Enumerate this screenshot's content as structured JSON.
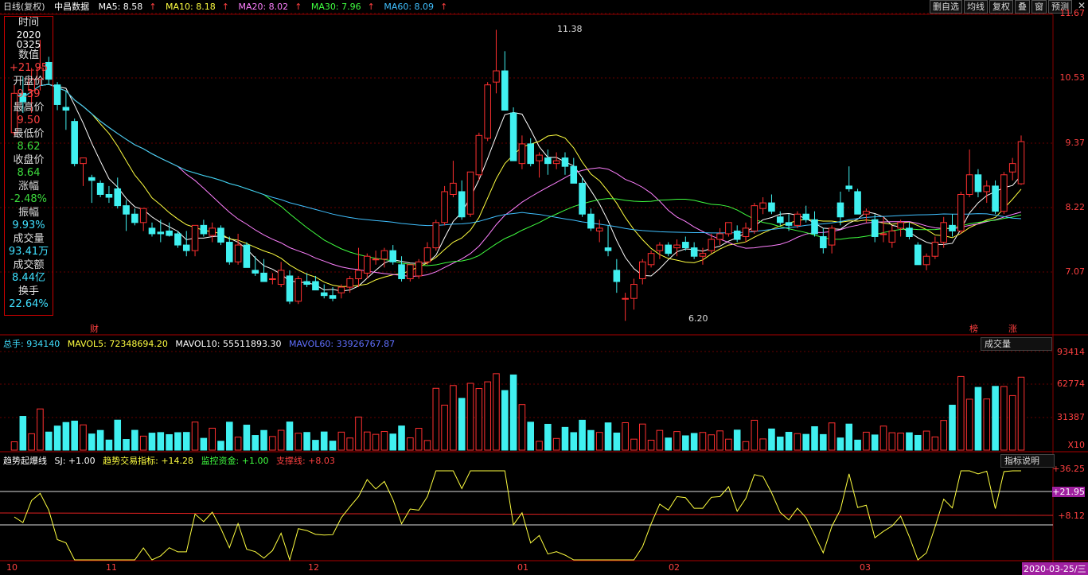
{
  "header": {
    "period": "日线(复权)",
    "name": "中昌数据",
    "ma": [
      {
        "label": "MA5: 8.58",
        "color": "#ffffff"
      },
      {
        "label": "MA10: 8.18",
        "color": "#ffff40"
      },
      {
        "label": "MA20: 8.02",
        "color": "#ff80ff"
      },
      {
        "label": "MA30: 7.96",
        "color": "#40ff40"
      },
      {
        "label": "MA60: 8.09",
        "color": "#40c0ff"
      }
    ],
    "buttons": [
      "删自选",
      "均线",
      "复权",
      "叠",
      "窗",
      "预测"
    ],
    "close": "✕"
  },
  "info": {
    "rows": [
      {
        "k": "时间",
        "v": "2020",
        "v2": "0325",
        "c": "white"
      },
      {
        "k": "数值",
        "v": "+21.95",
        "c": "red"
      },
      {
        "k": "开盘价",
        "v": "9.39",
        "c": "red"
      },
      {
        "k": "最高价",
        "v": "9.50",
        "c": "red"
      },
      {
        "k": "最低价",
        "v": "8.62",
        "c": "green"
      },
      {
        "k": "收盘价",
        "v": "8.64",
        "c": "green"
      },
      {
        "k": "涨幅",
        "v": "-2.48%",
        "c": "green"
      },
      {
        "k": "振幅",
        "v": "9.93%",
        "c": "cyan"
      },
      {
        "k": "成交量",
        "v": "93.41万",
        "c": "cyan"
      },
      {
        "k": "成交额",
        "v": "8.44亿",
        "c": "cyan"
      },
      {
        "k": "换手",
        "v": "22.64%",
        "c": "cyan"
      }
    ]
  },
  "price_axis": [
    "11.67",
    "10.53",
    "9.37",
    "8.22",
    "7.07"
  ],
  "annotations": {
    "high": "11.38",
    "low": "6.20",
    "cai": "财",
    "bang": "榜",
    "zhang": "涨"
  },
  "vol_bar": {
    "total": "总手: 934140",
    "mavol5": "MAVOL5: 72348694.20",
    "mavol10": "MAVOL10: 55511893.30",
    "mavol60": "MAVOL60: 33926767.87",
    "dropdown": "成交量"
  },
  "vol_axis": [
    "93414",
    "62774",
    "31387",
    "X10"
  ],
  "ind_bar": {
    "name": "趋势起爆线",
    "sj": "SJ: +1.00",
    "trade": "趋势交易指标: +14.28",
    "fund": "监控资金: +1.00",
    "support": "支撑线: +8.03",
    "button": "指标说明"
  },
  "ind_axis": [
    "+36.25",
    "+21.95",
    "+8.12"
  ],
  "x_labels": [
    "10",
    "11",
    "12",
    "01",
    "02",
    "03"
  ],
  "date_label": "2020-03-25/三",
  "chart_data": {
    "type": "candlestick",
    "ohlc": [
      [
        9.55,
        10.4,
        9.5,
        10.25
      ],
      [
        10.25,
        10.55,
        9.9,
        10.1
      ],
      [
        10.3,
        10.7,
        9.9,
        10.5
      ],
      [
        10.5,
        11.2,
        10.3,
        10.7
      ],
      [
        10.8,
        10.9,
        10.4,
        10.5
      ],
      [
        10.4,
        10.45,
        9.95,
        10.05
      ],
      [
        10.0,
        10.3,
        9.6,
        9.95
      ],
      [
        9.75,
        9.8,
        8.95,
        9.0
      ],
      [
        9.0,
        9.1,
        8.6,
        9.1
      ],
      [
        8.75,
        8.8,
        8.3,
        8.7
      ],
      [
        8.65,
        8.7,
        8.4,
        8.45
      ],
      [
        8.45,
        8.6,
        8.3,
        8.4
      ],
      [
        8.55,
        8.75,
        8.2,
        8.25
      ],
      [
        8.25,
        8.35,
        7.8,
        8.1
      ],
      [
        8.1,
        8.2,
        7.9,
        7.95
      ],
      [
        7.95,
        8.2,
        7.8,
        8.2
      ],
      [
        7.85,
        7.95,
        7.7,
        7.75
      ],
      [
        7.78,
        8.0,
        7.6,
        7.75
      ],
      [
        7.8,
        7.95,
        7.7,
        7.72
      ],
      [
        7.75,
        7.8,
        7.5,
        7.55
      ],
      [
        7.55,
        7.8,
        7.35,
        7.45
      ],
      [
        7.45,
        7.9,
        7.35,
        7.9
      ],
      [
        7.9,
        8.0,
        7.7,
        7.75
      ],
      [
        7.72,
        7.95,
        7.6,
        7.85
      ],
      [
        7.85,
        7.9,
        7.55,
        7.6
      ],
      [
        7.6,
        7.7,
        7.2,
        7.25
      ],
      [
        7.25,
        7.75,
        7.2,
        7.55
      ],
      [
        7.55,
        7.6,
        7.15,
        7.15
      ],
      [
        7.1,
        7.35,
        7.0,
        7.05
      ],
      [
        7.05,
        7.3,
        6.95,
        6.9
      ],
      [
        6.95,
        7.05,
        6.85,
        6.95
      ],
      [
        6.85,
        7.25,
        6.8,
        7.1
      ],
      [
        7.0,
        7.1,
        6.5,
        6.55
      ],
      [
        6.55,
        7.0,
        6.5,
        6.95
      ],
      [
        6.9,
        7.05,
        6.8,
        6.85
      ],
      [
        6.9,
        7.0,
        6.8,
        6.75
      ],
      [
        6.7,
        6.85,
        6.6,
        6.65
      ],
      [
        6.65,
        6.8,
        6.55,
        6.6
      ],
      [
        6.7,
        6.85,
        6.6,
        6.8
      ],
      [
        6.8,
        7.0,
        6.7,
        6.95
      ],
      [
        6.95,
        7.5,
        6.8,
        7.1
      ],
      [
        7.05,
        7.4,
        6.95,
        7.35
      ],
      [
        7.3,
        7.45,
        7.2,
        7.3
      ],
      [
        7.3,
        7.5,
        7.15,
        7.45
      ],
      [
        7.45,
        7.55,
        7.2,
        7.25
      ],
      [
        7.2,
        7.35,
        6.9,
        6.95
      ],
      [
        6.95,
        7.2,
        6.9,
        7.2
      ],
      [
        7.0,
        7.3,
        6.95,
        7.25
      ],
      [
        7.25,
        7.6,
        7.2,
        7.5
      ],
      [
        7.5,
        8.0,
        7.45,
        7.95
      ],
      [
        7.95,
        8.6,
        7.9,
        8.5
      ],
      [
        8.45,
        9.05,
        8.4,
        8.65
      ],
      [
        8.5,
        8.7,
        8.0,
        8.05
      ],
      [
        8.1,
        8.85,
        8.05,
        8.85
      ],
      [
        8.8,
        9.55,
        8.7,
        9.5
      ],
      [
        9.45,
        10.45,
        9.4,
        10.4
      ],
      [
        10.45,
        11.38,
        10.25,
        10.65
      ],
      [
        10.65,
        11.0,
        9.95,
        9.95
      ],
      [
        9.9,
        10.0,
        9.05,
        9.05
      ],
      [
        9.0,
        9.5,
        8.9,
        9.35
      ],
      [
        9.35,
        9.45,
        8.95,
        9.0
      ],
      [
        9.05,
        9.2,
        8.75,
        9.15
      ],
      [
        9.1,
        9.25,
        8.8,
        9.0
      ],
      [
        9.0,
        9.2,
        8.9,
        9.05
      ],
      [
        9.1,
        9.2,
        8.8,
        8.95
      ],
      [
        8.95,
        9.1,
        8.65,
        8.65
      ],
      [
        8.65,
        8.75,
        8.05,
        8.1
      ],
      [
        8.1,
        8.2,
        7.8,
        7.85
      ],
      [
        7.8,
        8.0,
        7.6,
        7.85
      ],
      [
        7.5,
        7.9,
        7.35,
        7.45
      ],
      [
        7.1,
        7.3,
        6.7,
        6.9
      ],
      [
        6.6,
        6.7,
        6.2,
        6.6
      ],
      [
        6.6,
        6.95,
        6.4,
        6.85
      ],
      [
        6.95,
        7.3,
        6.85,
        7.25
      ],
      [
        7.2,
        7.45,
        7.15,
        7.4
      ],
      [
        7.45,
        7.6,
        7.3,
        7.55
      ],
      [
        7.55,
        7.6,
        7.35,
        7.4
      ],
      [
        7.5,
        7.65,
        7.35,
        7.55
      ],
      [
        7.6,
        7.7,
        7.45,
        7.5
      ],
      [
        7.5,
        7.6,
        7.3,
        7.35
      ],
      [
        7.35,
        7.5,
        7.2,
        7.4
      ],
      [
        7.45,
        7.75,
        7.4,
        7.65
      ],
      [
        7.65,
        7.85,
        7.55,
        7.75
      ],
      [
        7.75,
        7.95,
        7.7,
        7.95
      ],
      [
        7.8,
        7.9,
        7.6,
        7.65
      ],
      [
        7.7,
        7.95,
        7.6,
        7.85
      ],
      [
        7.8,
        8.3,
        7.75,
        8.25
      ],
      [
        8.2,
        8.4,
        8.1,
        8.3
      ],
      [
        8.3,
        8.45,
        8.1,
        8.15
      ],
      [
        8.05,
        8.15,
        7.9,
        7.95
      ],
      [
        7.95,
        8.1,
        7.8,
        7.9
      ],
      [
        7.9,
        8.15,
        7.85,
        8.1
      ],
      [
        8.1,
        8.25,
        7.95,
        8.0
      ],
      [
        8.0,
        8.15,
        7.7,
        7.75
      ],
      [
        7.7,
        7.85,
        7.4,
        7.5
      ],
      [
        7.55,
        7.9,
        7.4,
        7.85
      ],
      [
        8.3,
        8.5,
        7.9,
        8.05
      ],
      [
        8.6,
        8.95,
        8.5,
        8.55
      ],
      [
        8.5,
        8.55,
        8.1,
        8.1
      ],
      [
        8.1,
        8.2,
        7.95,
        8.15
      ],
      [
        8.0,
        8.1,
        7.6,
        7.7
      ],
      [
        7.75,
        8.05,
        7.6,
        7.75
      ],
      [
        7.6,
        7.9,
        7.5,
        7.8
      ],
      [
        7.85,
        8.0,
        7.7,
        7.95
      ],
      [
        7.85,
        7.95,
        7.65,
        7.7
      ],
      [
        7.55,
        7.6,
        7.3,
        7.2
      ],
      [
        7.2,
        7.4,
        7.1,
        7.35
      ],
      [
        7.35,
        7.7,
        7.3,
        7.6
      ],
      [
        7.6,
        8.05,
        7.5,
        7.95
      ],
      [
        7.9,
        8.1,
        7.7,
        7.8
      ],
      [
        7.8,
        8.5,
        7.75,
        8.45
      ],
      [
        8.45,
        9.25,
        8.4,
        8.8
      ],
      [
        8.8,
        8.9,
        8.4,
        8.5
      ],
      [
        8.5,
        8.7,
        8.3,
        8.6
      ],
      [
        8.6,
        8.7,
        8.1,
        8.15
      ],
      [
        8.15,
        8.85,
        8.1,
        8.8
      ],
      [
        8.85,
        9.1,
        8.7,
        9.0
      ],
      [
        8.64,
        9.5,
        8.62,
        9.39
      ]
    ],
    "volume_note": "bars proportional to daily volume",
    "ma_lines": [
      "MA5",
      "MA10",
      "MA20",
      "MA30",
      "MA60"
    ]
  }
}
